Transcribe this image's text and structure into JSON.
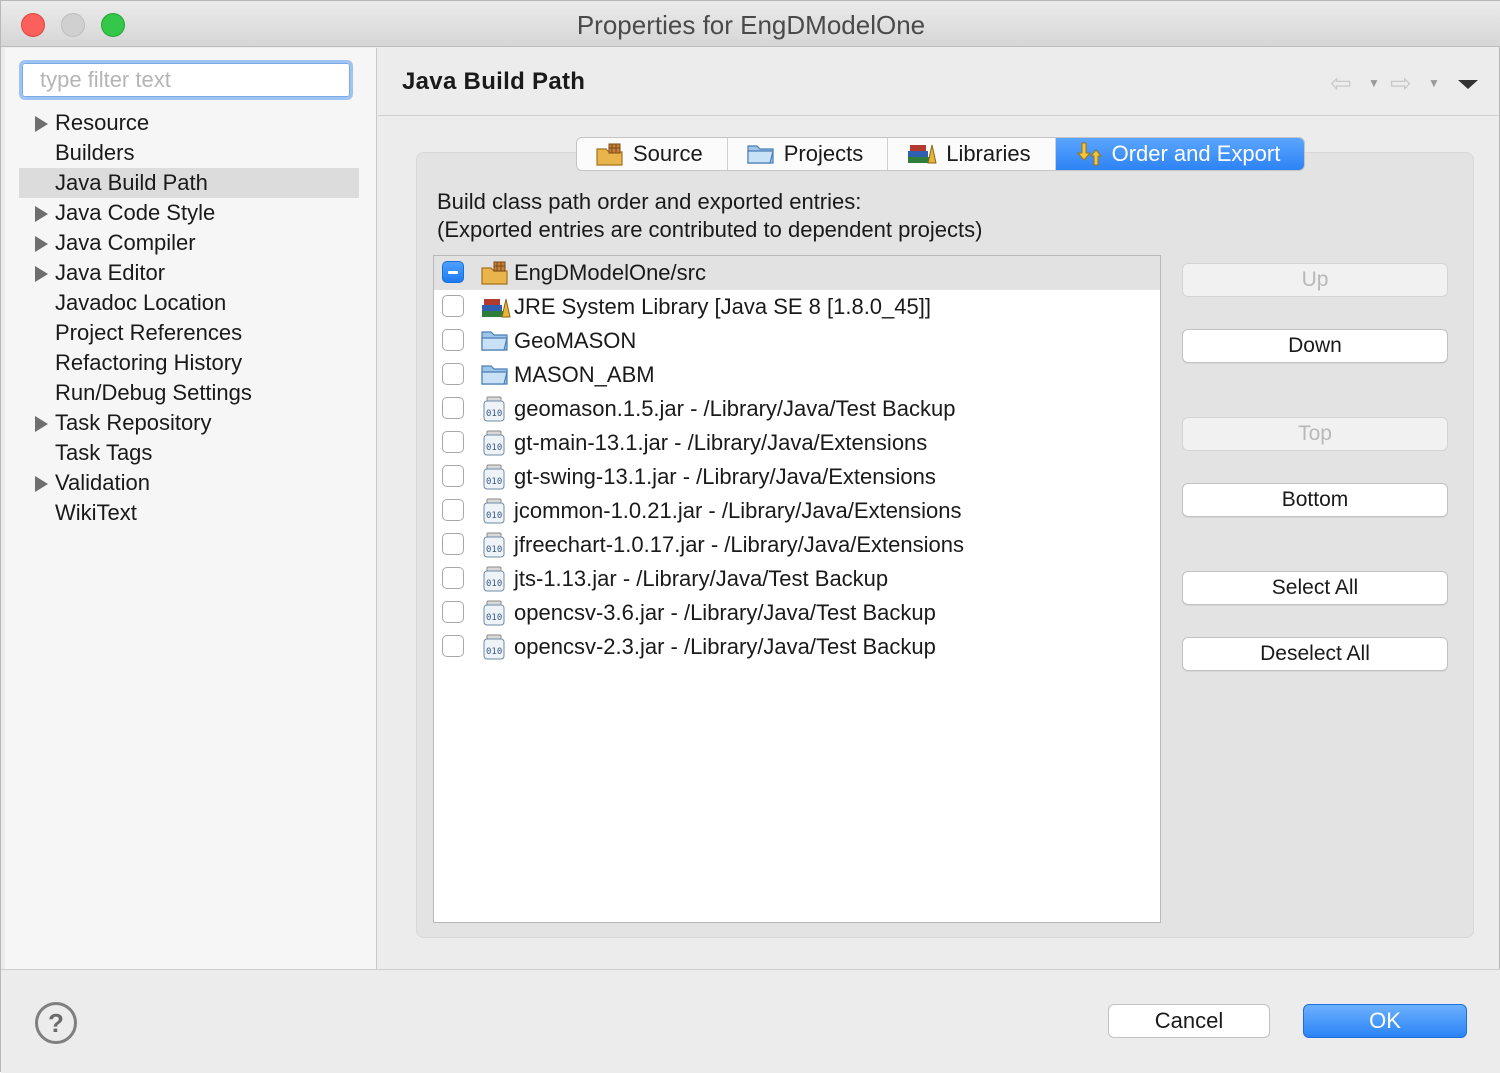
{
  "window": {
    "title": "Properties for EngDModelOne"
  },
  "filter": {
    "placeholder": "type filter text"
  },
  "tree": {
    "items": [
      {
        "label": "Resource",
        "expandable": true,
        "selected": false
      },
      {
        "label": "Builders",
        "expandable": false,
        "selected": false
      },
      {
        "label": "Java Build Path",
        "expandable": false,
        "selected": true
      },
      {
        "label": "Java Code Style",
        "expandable": true,
        "selected": false
      },
      {
        "label": "Java Compiler",
        "expandable": true,
        "selected": false
      },
      {
        "label": "Java Editor",
        "expandable": true,
        "selected": false
      },
      {
        "label": "Javadoc Location",
        "expandable": false,
        "selected": false
      },
      {
        "label": "Project References",
        "expandable": false,
        "selected": false
      },
      {
        "label": "Refactoring History",
        "expandable": false,
        "selected": false
      },
      {
        "label": "Run/Debug Settings",
        "expandable": false,
        "selected": false
      },
      {
        "label": "Task Repository",
        "expandable": true,
        "selected": false
      },
      {
        "label": "Task Tags",
        "expandable": false,
        "selected": false
      },
      {
        "label": "Validation",
        "expandable": true,
        "selected": false
      },
      {
        "label": "WikiText",
        "expandable": false,
        "selected": false
      }
    ]
  },
  "page": {
    "title": "Java Build Path",
    "tabs": [
      {
        "label": "Source",
        "icon": "source-folder-icon",
        "active": false
      },
      {
        "label": "Projects",
        "icon": "folder-icon",
        "active": false
      },
      {
        "label": "Libraries",
        "icon": "library-icon",
        "active": false
      },
      {
        "label": "Order and Export",
        "icon": "order-export-icon",
        "active": true
      }
    ],
    "description_line1": "Build class path order and exported entries:",
    "description_line2": "(Exported entries are contributed to dependent projects)",
    "entries": [
      {
        "label": "EngDModelOne/src",
        "icon": "source-folder-icon",
        "check": "mixed",
        "selected": true
      },
      {
        "label": "JRE System Library [Java SE 8 [1.8.0_45]]",
        "icon": "library-icon",
        "check": "unchecked",
        "selected": false
      },
      {
        "label": "GeoMASON",
        "icon": "project-folder-icon",
        "check": "unchecked",
        "selected": false
      },
      {
        "label": "MASON_ABM",
        "icon": "project-folder-icon",
        "check": "unchecked",
        "selected": false
      },
      {
        "label": "geomason.1.5.jar - /Library/Java/Test Backup",
        "icon": "jar-icon",
        "check": "unchecked",
        "selected": false
      },
      {
        "label": "gt-main-13.1.jar - /Library/Java/Extensions",
        "icon": "jar-icon",
        "check": "unchecked",
        "selected": false
      },
      {
        "label": "gt-swing-13.1.jar - /Library/Java/Extensions",
        "icon": "jar-icon",
        "check": "unchecked",
        "selected": false
      },
      {
        "label": "jcommon-1.0.21.jar - /Library/Java/Extensions",
        "icon": "jar-icon",
        "check": "unchecked",
        "selected": false
      },
      {
        "label": "jfreechart-1.0.17.jar - /Library/Java/Extensions",
        "icon": "jar-icon",
        "check": "unchecked",
        "selected": false
      },
      {
        "label": "jts-1.13.jar - /Library/Java/Test Backup",
        "icon": "jar-icon",
        "check": "unchecked",
        "selected": false
      },
      {
        "label": "opencsv-3.6.jar - /Library/Java/Test Backup",
        "icon": "jar-icon",
        "check": "unchecked",
        "selected": false
      },
      {
        "label": "opencsv-2.3.jar - /Library/Java/Test Backup",
        "icon": "jar-icon",
        "check": "unchecked",
        "selected": false
      }
    ],
    "buttons": {
      "up": "Up",
      "down": "Down",
      "top": "Top",
      "bottom": "Bottom",
      "select_all": "Select All",
      "deselect_all": "Deselect All"
    }
  },
  "footer": {
    "help": "?",
    "cancel": "Cancel",
    "ok": "OK"
  },
  "colors": {
    "accent": "#2d83f5",
    "selection": "#dcdcdc"
  }
}
